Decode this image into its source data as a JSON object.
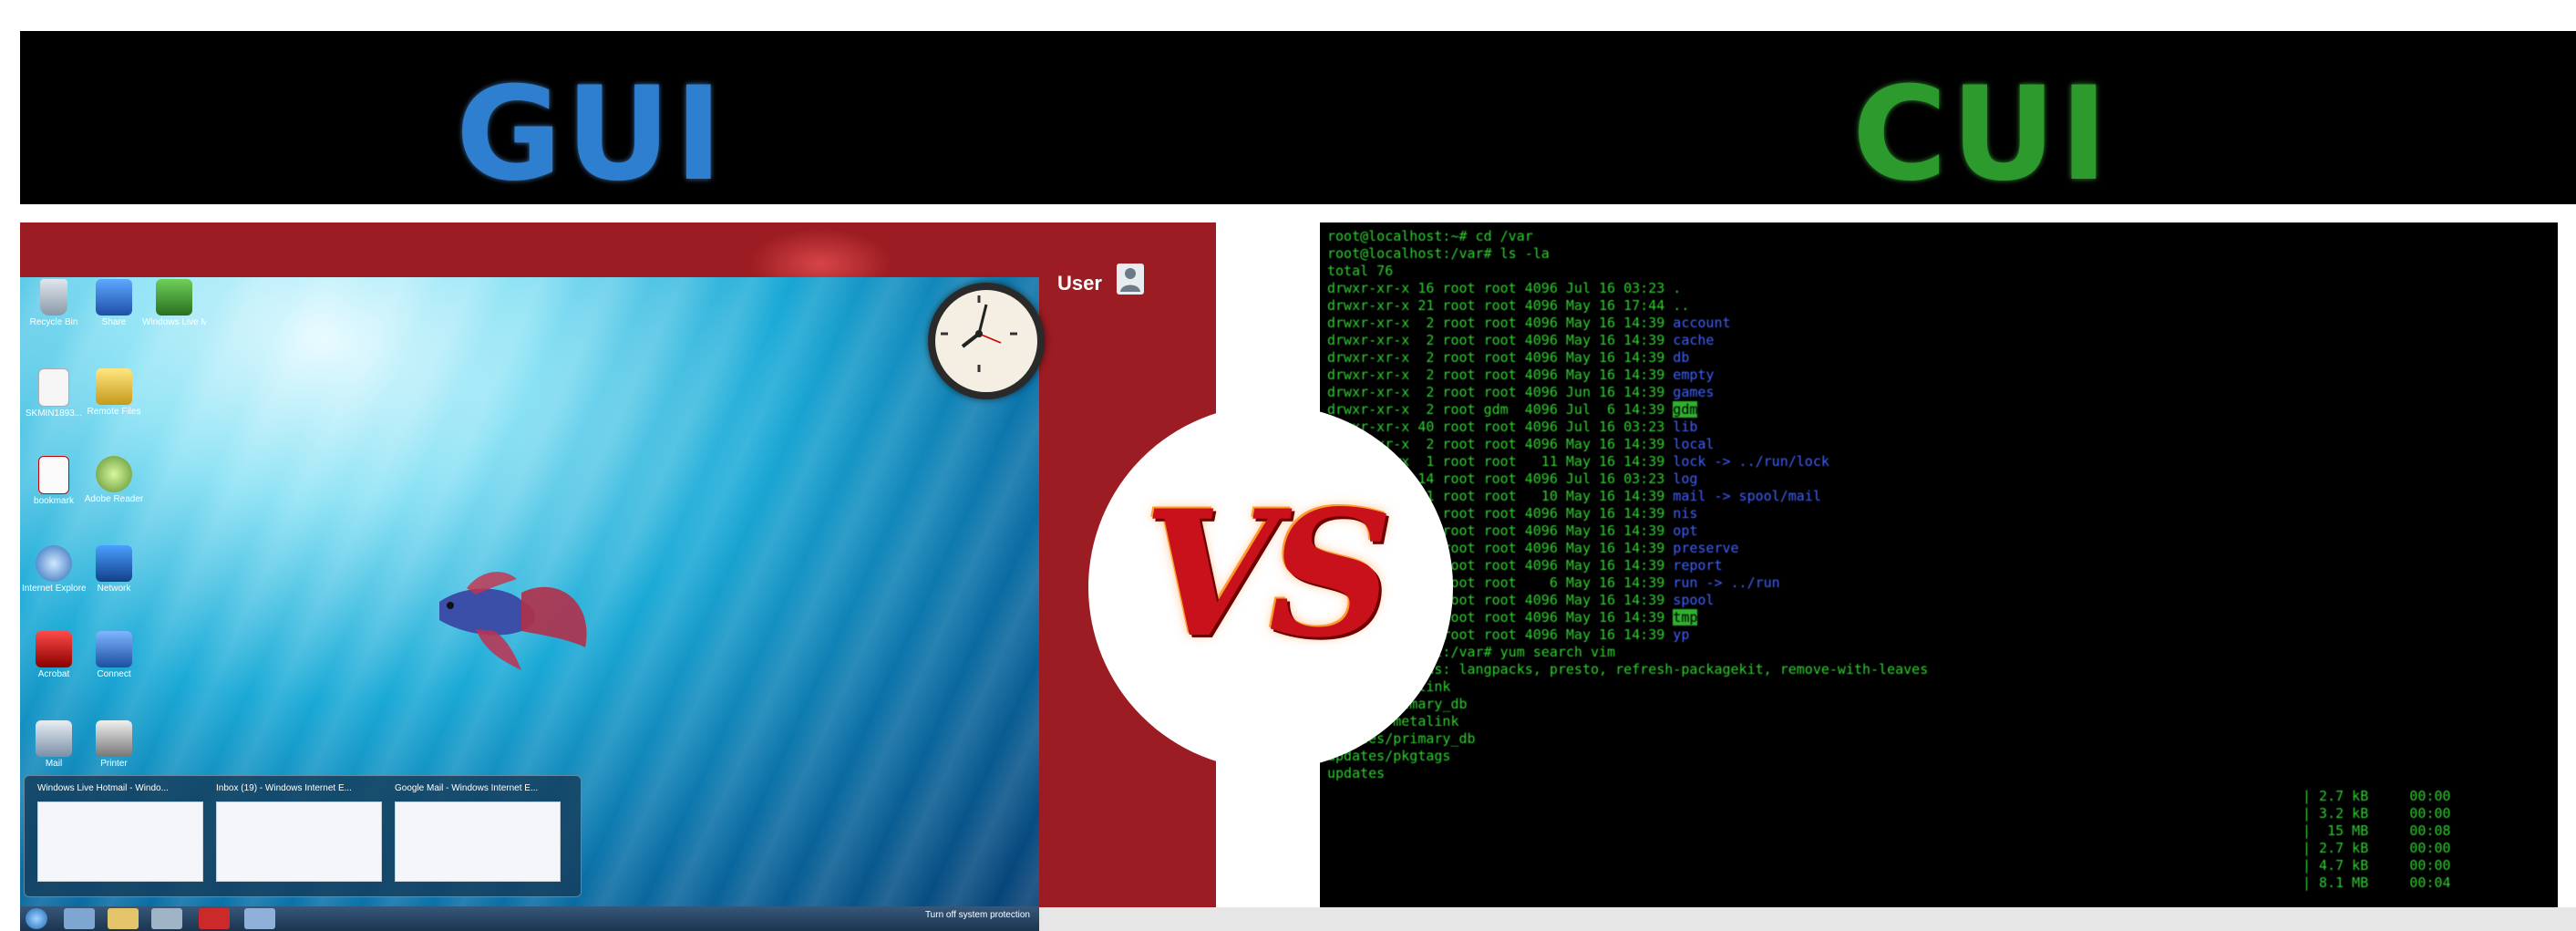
{
  "header": {
    "left_title": "GUI",
    "right_title": "CUI",
    "colors": {
      "gui": "#2f7fd1",
      "cui": "#2d9a2d",
      "bar": "#000000"
    }
  },
  "divider": {
    "label": "VS",
    "color": "#c8111a"
  },
  "gui": {
    "user_label": "User",
    "desktop_icons": [
      {
        "label": "Recycle Bin",
        "icon": "recycle-bin-icon"
      },
      {
        "label": "Share",
        "icon": "share-icon"
      },
      {
        "label": "Windows Live Mo...",
        "icon": "movie-maker-icon"
      },
      {
        "label": "SKMIN1893...",
        "icon": "document-icon"
      },
      {
        "label": "Remote Files",
        "icon": "remote-files-icon"
      },
      {
        "label": "bookmark",
        "icon": "pdf-icon"
      },
      {
        "label": "Adobe Reader",
        "icon": "globe-icon"
      },
      {
        "label": "Internet Explorer",
        "icon": "internet-explorer-icon"
      },
      {
        "label": "Network",
        "icon": "network-icon"
      },
      {
        "label": "Acrobat",
        "icon": "acrobat-icon"
      },
      {
        "label": "Connect",
        "icon": "connect-icon"
      },
      {
        "label": "Mail",
        "icon": "mail-icon"
      },
      {
        "label": "Printer",
        "icon": "printer-icon"
      }
    ],
    "taskbar_previews": [
      {
        "title": "Windows Live Hotmail - Windo..."
      },
      {
        "title": "Inbox (19) - Windows Internet E..."
      },
      {
        "title": "Google Mail - Windows Internet E..."
      }
    ],
    "tray_text": "Turn off system protection",
    "colors": {
      "red_bg": "#9b1c22",
      "taskbar": "#2b4866"
    }
  },
  "cui": {
    "lines": [
      {
        "g": "root@localhost:~# cd /var"
      },
      {
        "g": "root@localhost:/var# ls -la"
      },
      {
        "g": "total 76"
      },
      {
        "g": "drwxr-xr-x 16 root root 4096 Jul 16 03:23 ."
      },
      {
        "g": "drwxr-xr-x 21 root root 4096 May 16 17:44 .."
      },
      {
        "g": "drwxr-xr-x  2 root root 4096 May 16 14:39 ",
        "b": "account"
      },
      {
        "g": "drwxr-xr-x  2 root root 4096 May 16 14:39 ",
        "b": "cache"
      },
      {
        "g": "drwxr-xr-x  2 root root 4096 May 16 14:39 ",
        "b": "db"
      },
      {
        "g": "drwxr-xr-x  2 root root 4096 May 16 14:39 ",
        "b": "empty"
      },
      {
        "g": "drwxr-xr-x  2 root root 4096 Jun 16 14:39 ",
        "b": "games"
      },
      {
        "g": "drwxr-xr-x  2 root gdm  4096 Jul  6 14:39 ",
        "b": "gdm",
        "hl": true
      },
      {
        "g": "drwxr-xr-x 40 root root 4096 Jul 16 03:23 ",
        "b": "lib"
      },
      {
        "g": "drwxr-xr-x  2 root root 4096 May 16 14:39 ",
        "b": "local"
      },
      {
        "g": "lrwxrwxrwx  1 root root   11 May 16 14:39 ",
        "b": "lock -> ../run/lock"
      },
      {
        "g": "drwxr-xr-x 14 root root 4096 Jul 16 03:23 ",
        "b": "log"
      },
      {
        "g": "lrwxrwxrwx  1 root root   10 May 16 14:39 ",
        "b": "mail -> spool/mail"
      },
      {
        "g": "drwxr-xr-x  2 root root 4096 May 16 14:39 ",
        "b": "nis"
      },
      {
        "g": "drwxr-xr-x  2 root root 4096 May 16 14:39 ",
        "b": "opt"
      },
      {
        "g": "drwxr-xr-x  2 root root 4096 May 16 14:39 ",
        "b": "preserve"
      },
      {
        "g": "drwxr-xr-x  2 root root 4096 May 16 14:39 ",
        "b": "report"
      },
      {
        "g": "lrwxrwxrwx  1 root root    6 May 16 14:39 ",
        "b": "run -> ../run"
      },
      {
        "g": "drwxr-xr-x 12 root root 4096 May 16 14:39 ",
        "b": "spool"
      },
      {
        "g": "drwxrwxrwt  5 root root 4096 May 16 14:39 ",
        "b": "tmp",
        "hl": true
      },
      {
        "g": "drwxr-xr-x  2 root root 4096 May 16 14:39 ",
        "b": "yp"
      },
      {
        "g": "root@localhost:/var# yum search vim"
      },
      {
        "g": "Loaded plugins: langpacks, presto, refresh-packagekit, remove-with-leaves"
      },
      {
        "g": "fedora/metalink"
      },
      {
        "g": "fedora/primary_db"
      },
      {
        "g": "updates/metalink"
      },
      {
        "g": "updates/primary_db"
      },
      {
        "g": "updates/pkgtags"
      },
      {
        "g": "updates"
      }
    ],
    "right_columns": [
      "| 2.7 kB     00:00",
      "| 3.2 kB     00:00",
      "|  15 MB     00:08",
      "| 2.7 kB     00:00",
      "| 4.7 kB     00:00",
      "| 8.1 MB     00:04"
    ],
    "colors": {
      "text": "#2fd02f",
      "dir": "#4060ff",
      "bg": "#000000"
    }
  }
}
